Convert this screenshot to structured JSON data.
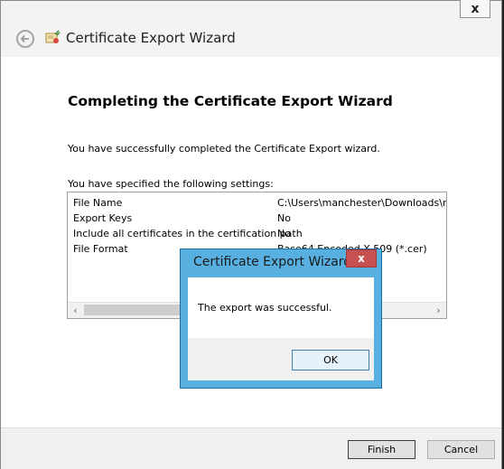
{
  "wizard": {
    "title": "Certificate Export Wizard",
    "close_label": "x",
    "heading": "Completing the Certificate Export Wizard",
    "description": "You have successfully completed the Certificate Export wizard.",
    "settings_intro": "You have specified the following settings:",
    "settings": [
      {
        "name": "File Name",
        "value": "C:\\Users\\manchester\\Downloads\\manc"
      },
      {
        "name": "Export Keys",
        "value": "No"
      },
      {
        "name": "Include all certificates in the certification path",
        "value": "No"
      },
      {
        "name": "File Format",
        "value": "Base64 Encoded X.509 (*.cer)"
      }
    ],
    "finish_label": "Finish",
    "cancel_label": "Cancel"
  },
  "message_box": {
    "title": "Certificate Export Wizard",
    "close_label": "x",
    "message": "The export was successful.",
    "ok_label": "OK"
  },
  "icons": {
    "back": "back-arrow-icon",
    "wizard": "certificate-icon",
    "scroll_left": "chevron-left-icon",
    "scroll_right": "chevron-right-icon"
  }
}
